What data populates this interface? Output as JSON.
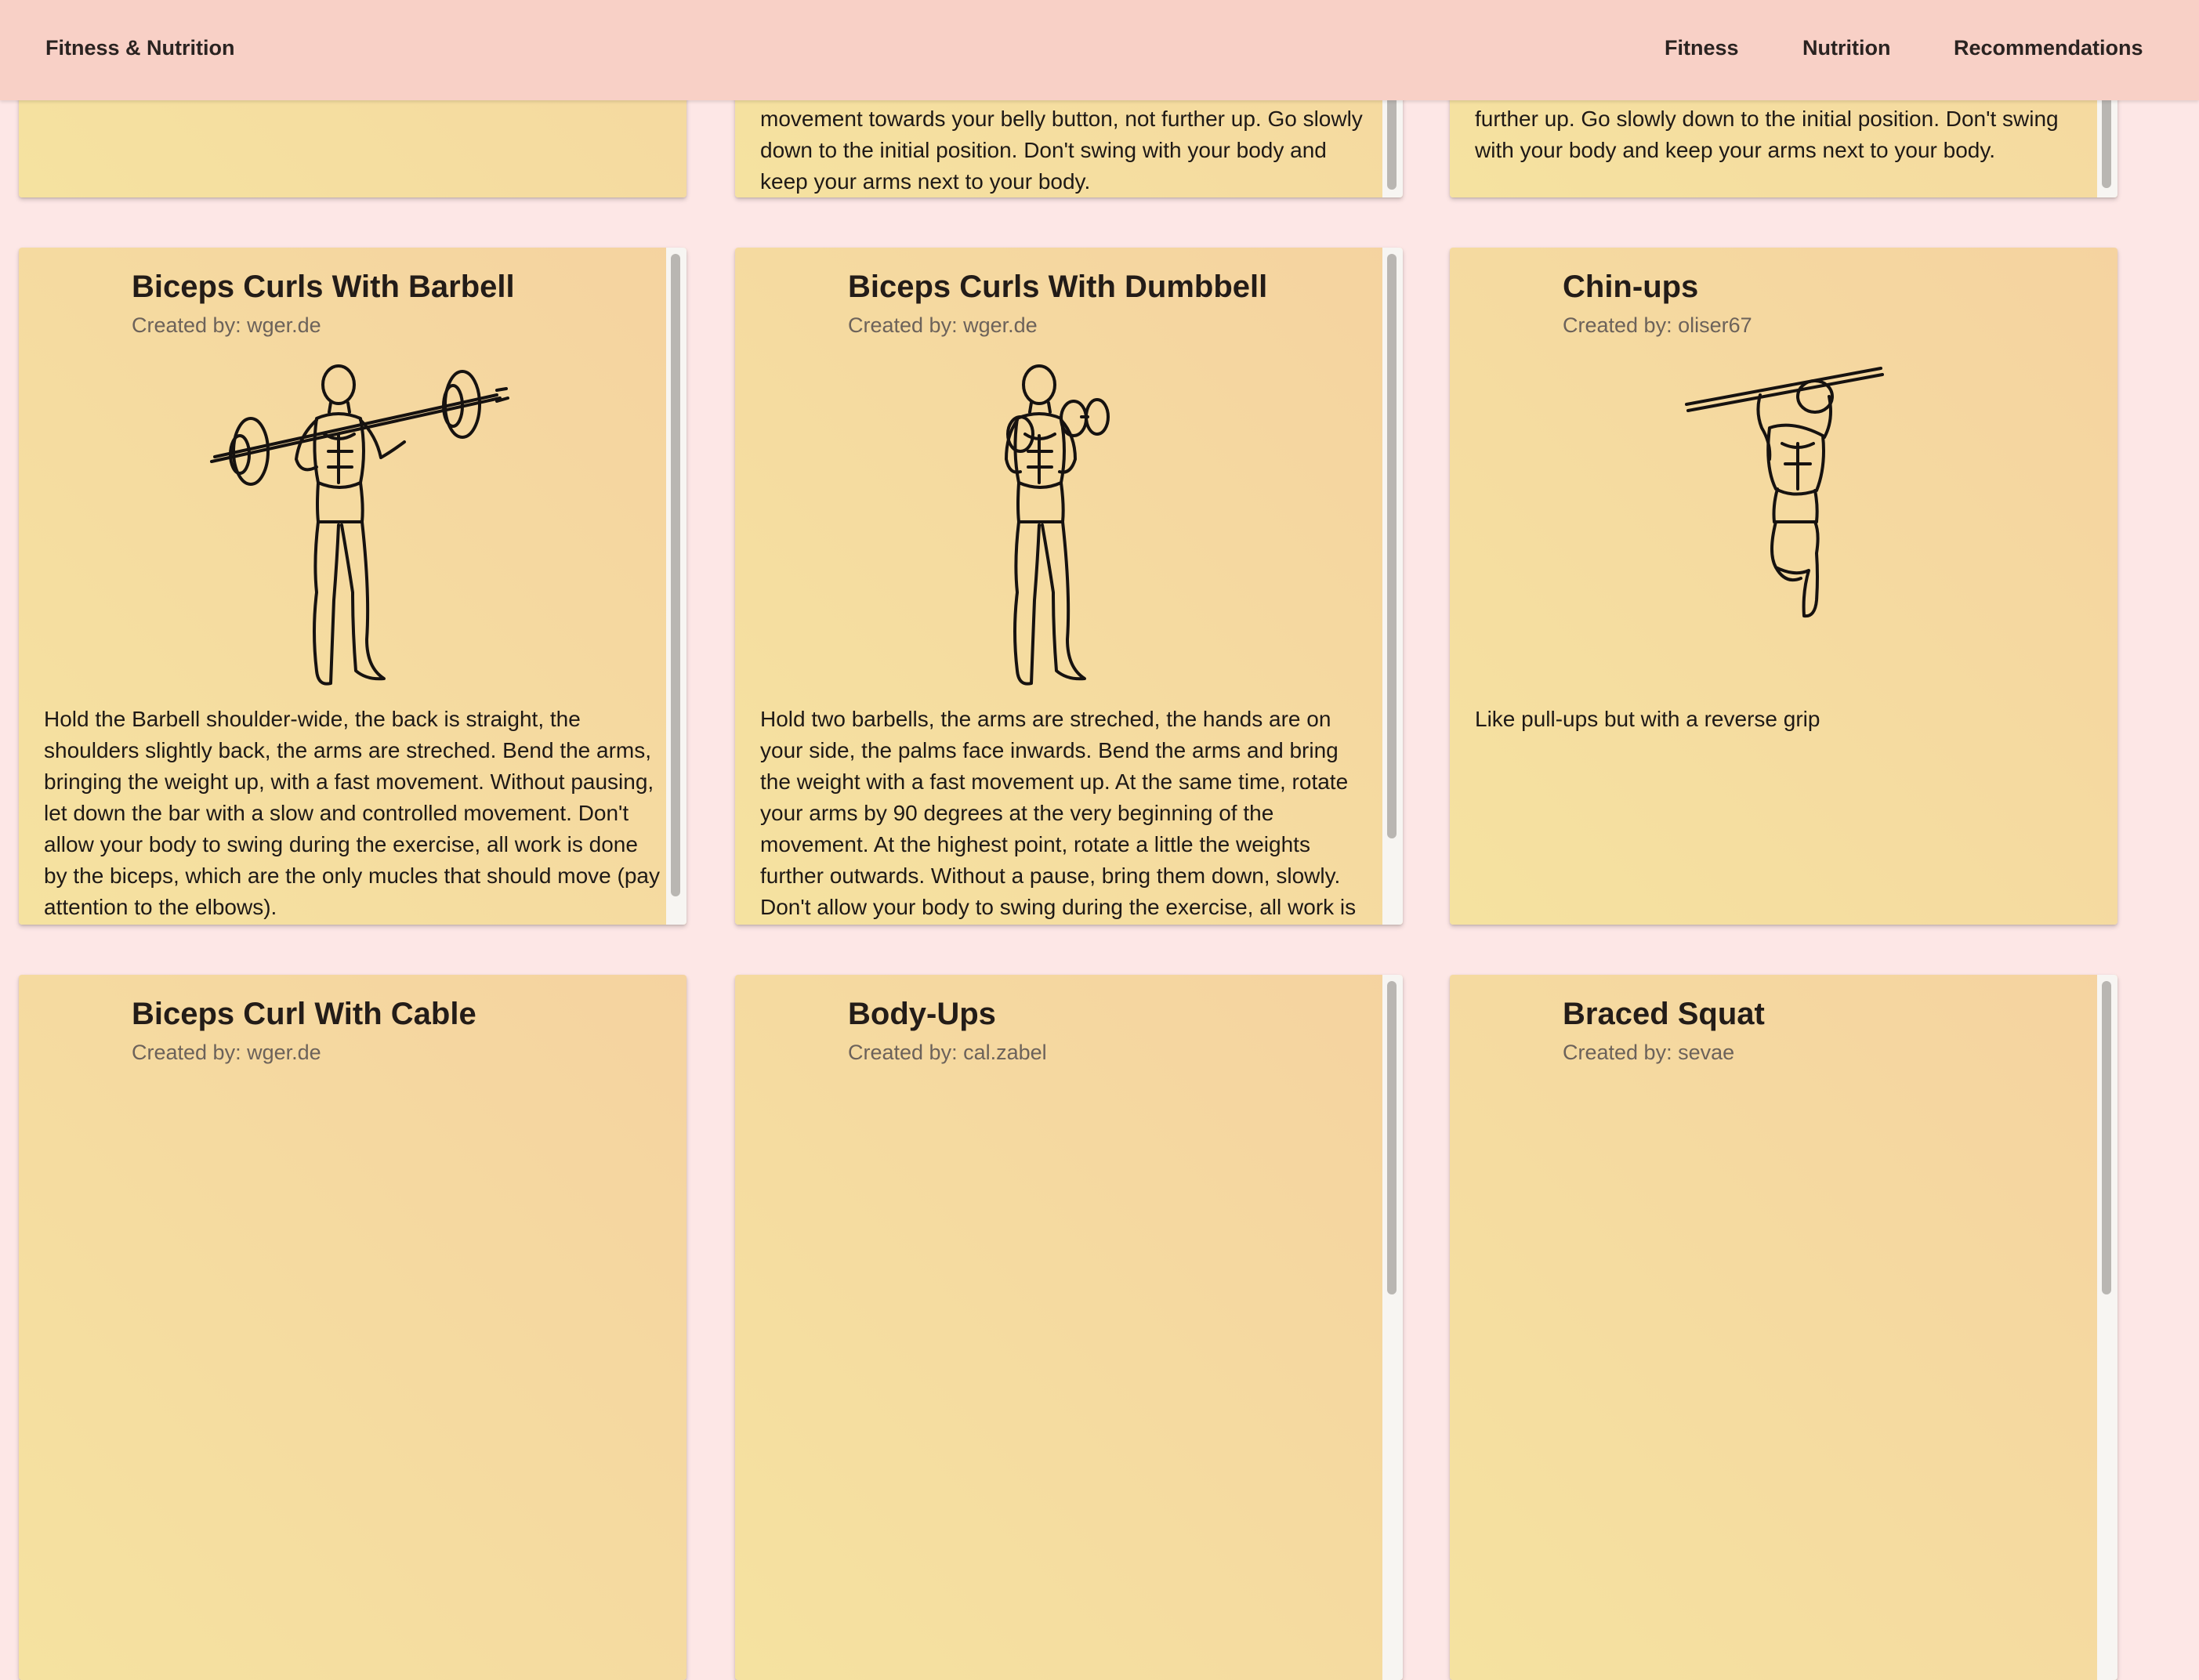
{
  "nav": {
    "brand": "Fitness & Nutrition",
    "links": [
      "Fitness",
      "Nutrition",
      "Recommendations"
    ]
  },
  "created_by_prefix": "Created by: ",
  "row0": {
    "card2_text": "movement towards your belly button, not further up. Go slowly down to the initial position. Don't swing with your body and keep your arms next to your body.",
    "card3_text": "the barbell with a fast movement towards your belly button, not further up. Go slowly down to the initial position. Don't swing with your body and keep your arms next to your body."
  },
  "row1": [
    {
      "title": "Biceps Curls With Barbell",
      "author": "wger.de",
      "image": "man-barbell-curl-illustration",
      "text": "Hold the Barbell shoulder-wide, the back is straight, the shoulders slightly back, the arms are streched. Bend the arms, bringing the weight up, with a fast movement. Without pausing, let down the bar with a slow and controlled movement. Don't allow your body to swing during the exercise, all work is done by the biceps, which are the only mucles that should move (pay attention to the elbows)."
    },
    {
      "title": "Biceps Curls With Dumbbell",
      "author": "wger.de",
      "image": "man-dumbbell-curl-illustration",
      "text": "Hold two barbells, the arms are streched, the hands are on your side, the palms face inwards. Bend the arms and bring the weight with a fast movement up. At the same time, rotate your arms by 90 degrees at the very beginning of the movement. At the highest point, rotate a little the weights further outwards. Without a pause, bring them down, slowly. Don't allow your body to swing during the exercise, all work is"
    },
    {
      "title": "Chin-ups",
      "author": "oliser67",
      "image": "man-chin-up-illustration",
      "text": "Like pull-ups but with a reverse grip"
    }
  ],
  "row2": [
    {
      "title": "Biceps Curl With Cable",
      "author": "wger.de"
    },
    {
      "title": "Body-Ups",
      "author": "cal.zabel"
    },
    {
      "title": "Braced Squat",
      "author": "sevae"
    }
  ]
}
